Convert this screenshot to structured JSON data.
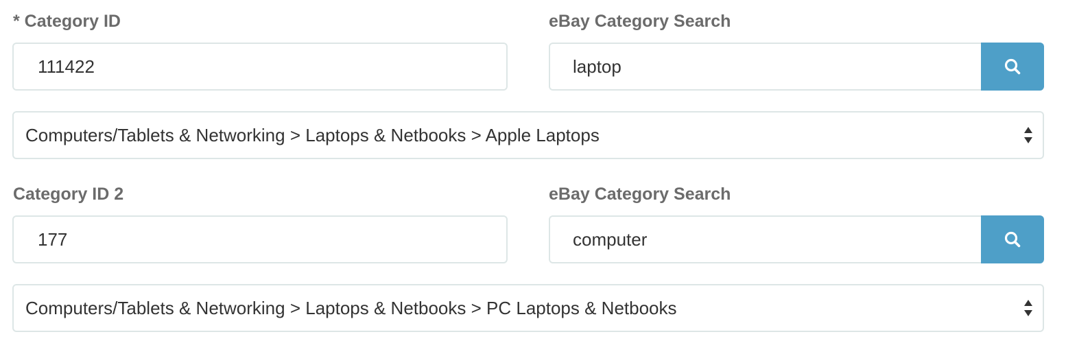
{
  "row1": {
    "category_label": "* Category ID",
    "category_value": "111422",
    "search_label": "eBay Category Search",
    "search_value": "laptop",
    "search_button_icon": "search-icon",
    "select_value": "Computers/Tablets & Networking > Laptops & Netbooks > Apple Laptops"
  },
  "row2": {
    "category_label": "Category ID 2",
    "category_value": "177",
    "search_label": "eBay Category Search",
    "search_value": "computer",
    "search_button_icon": "search-icon",
    "select_value": "Computers/Tablets & Networking > Laptops & Netbooks > PC Laptops & Netbooks"
  },
  "colors": {
    "button": "#4e9fc8",
    "border": "#dde6e6",
    "label": "#6b6b6b"
  }
}
